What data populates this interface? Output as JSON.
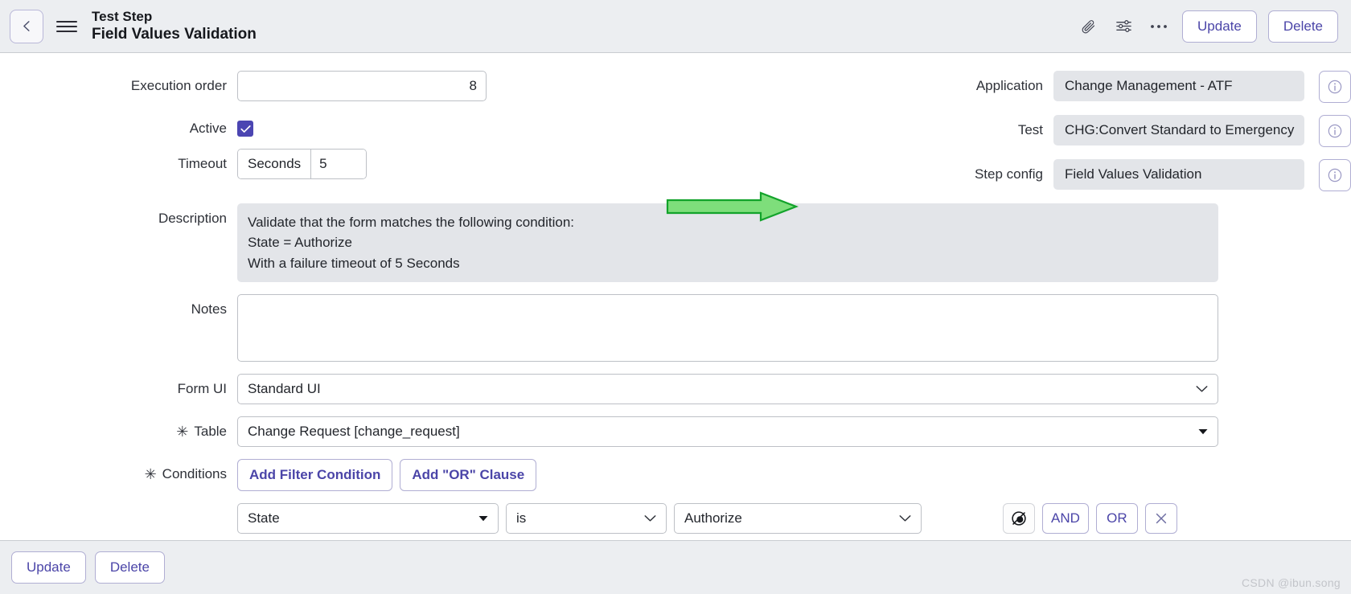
{
  "header": {
    "back_icon": "chevron-left-icon",
    "menu_icon": "hamburger-icon",
    "title_small": "Test Step",
    "title_main": "Field Values Validation",
    "attachment_icon": "paperclip-icon",
    "personalize_icon": "sliders-icon",
    "more_icon": "ellipsis-icon",
    "update_label": "Update",
    "delete_label": "Delete"
  },
  "form": {
    "execution_order": {
      "label": "Execution order",
      "value": "8"
    },
    "active": {
      "label": "Active",
      "checked": true,
      "icon": "check-icon"
    },
    "timeout": {
      "label": "Timeout",
      "unit": "Seconds",
      "value": "5"
    },
    "description": {
      "label": "Description",
      "line1": "Validate that the form matches the following condition:",
      "line2": "State = Authorize",
      "line3": "With a failure timeout of 5 Seconds"
    },
    "notes": {
      "label": "Notes",
      "value": ""
    },
    "form_ui": {
      "label": "Form UI",
      "value": "Standard UI",
      "icon": "chevron-down-icon"
    },
    "table": {
      "label": "Table",
      "required_marker": "✳",
      "value": "Change Request [change_request]",
      "icon": "triangle-down-icon"
    },
    "application": {
      "label": "Application",
      "value": "Change Management - ATF",
      "info_icon": "info-icon"
    },
    "test": {
      "label": "Test",
      "value": "CHG:Convert Standard to Emergency",
      "info_icon": "info-icon"
    },
    "step_config": {
      "label": "Step config",
      "value": "Field Values Validation",
      "info_icon": "info-icon"
    }
  },
  "conditions": {
    "label": "Conditions",
    "required_marker": "✳",
    "add_filter_label": "Add Filter Condition",
    "add_or_label": "Add \"OR\" Clause",
    "rows": [
      {
        "field": "State",
        "field_icon": "triangle-down-icon",
        "operator": "is",
        "operator_icon": "chevron-down-icon",
        "value": "Authorize",
        "value_icon": "chevron-down-icon",
        "dynamic_icon": "dynamic-filter-icon",
        "and_label": "AND",
        "or_label": "OR",
        "remove_icon": "close-icon"
      }
    ]
  },
  "footer": {
    "update_label": "Update",
    "delete_label": "Delete"
  },
  "annotation": {
    "arrow_icon": "green-arrow-right-icon",
    "fill": "#7ede7b",
    "stroke": "#13a32b"
  },
  "watermark": {
    "text": "CSDN @ibun.song"
  }
}
